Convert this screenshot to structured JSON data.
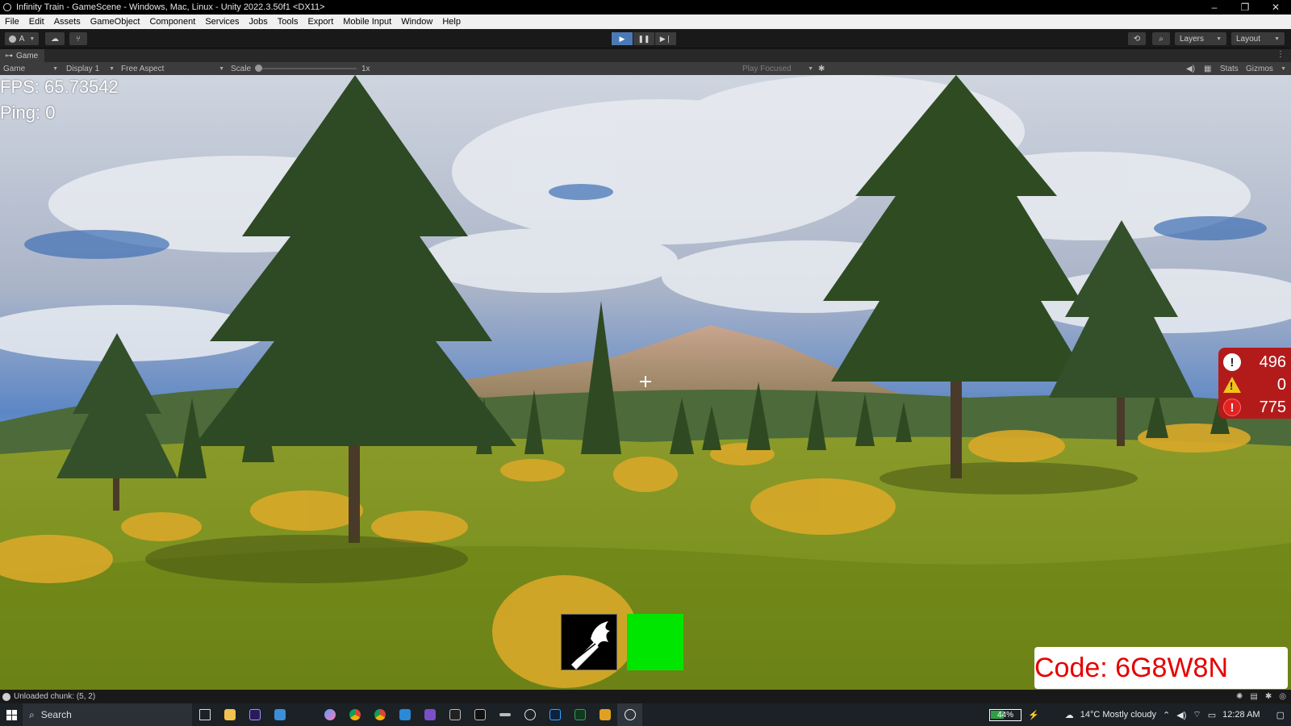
{
  "window": {
    "title": "Infinity Train - GameScene - Windows, Mac, Linux - Unity 2022.3.50f1 <DX11>",
    "controls": [
      "–",
      "❐",
      "✕"
    ]
  },
  "menu": [
    "File",
    "Edit",
    "Assets",
    "GameObject",
    "Component",
    "Services",
    "Jobs",
    "Tools",
    "Export",
    "Mobile Input",
    "Window",
    "Help"
  ],
  "toolbar": {
    "account_label": "A",
    "layers_label": "Layers",
    "layout_label": "Layout"
  },
  "game_tab": {
    "label": "Game"
  },
  "game_bar": {
    "mode": "Game",
    "display": "Display 1",
    "aspect": "Free Aspect",
    "scale_label": "Scale",
    "scale_value": "1x",
    "play_focus": "Play Focused",
    "stats": "Stats",
    "gizmos": "Gizmos"
  },
  "hud": {
    "fps": "FPS: 65.73542",
    "ping": "Ping: 0",
    "console_counts": {
      "info": "496",
      "warnings": "0",
      "errors": "775"
    },
    "code": "Code: 6G8W8N"
  },
  "status_bar": {
    "message": "Unloaded chunk: (5, 2)"
  },
  "taskbar": {
    "search_placeholder": "Search",
    "battery": "44%",
    "battery_level": 0.44,
    "weather": "14°C  Mostly cloudy",
    "time": "12:28 AM"
  },
  "colors": {
    "play_active": "#4b79b6",
    "error_panel": "#b31b1b",
    "code_text": "#e60000",
    "green_slot": "#00e600"
  }
}
